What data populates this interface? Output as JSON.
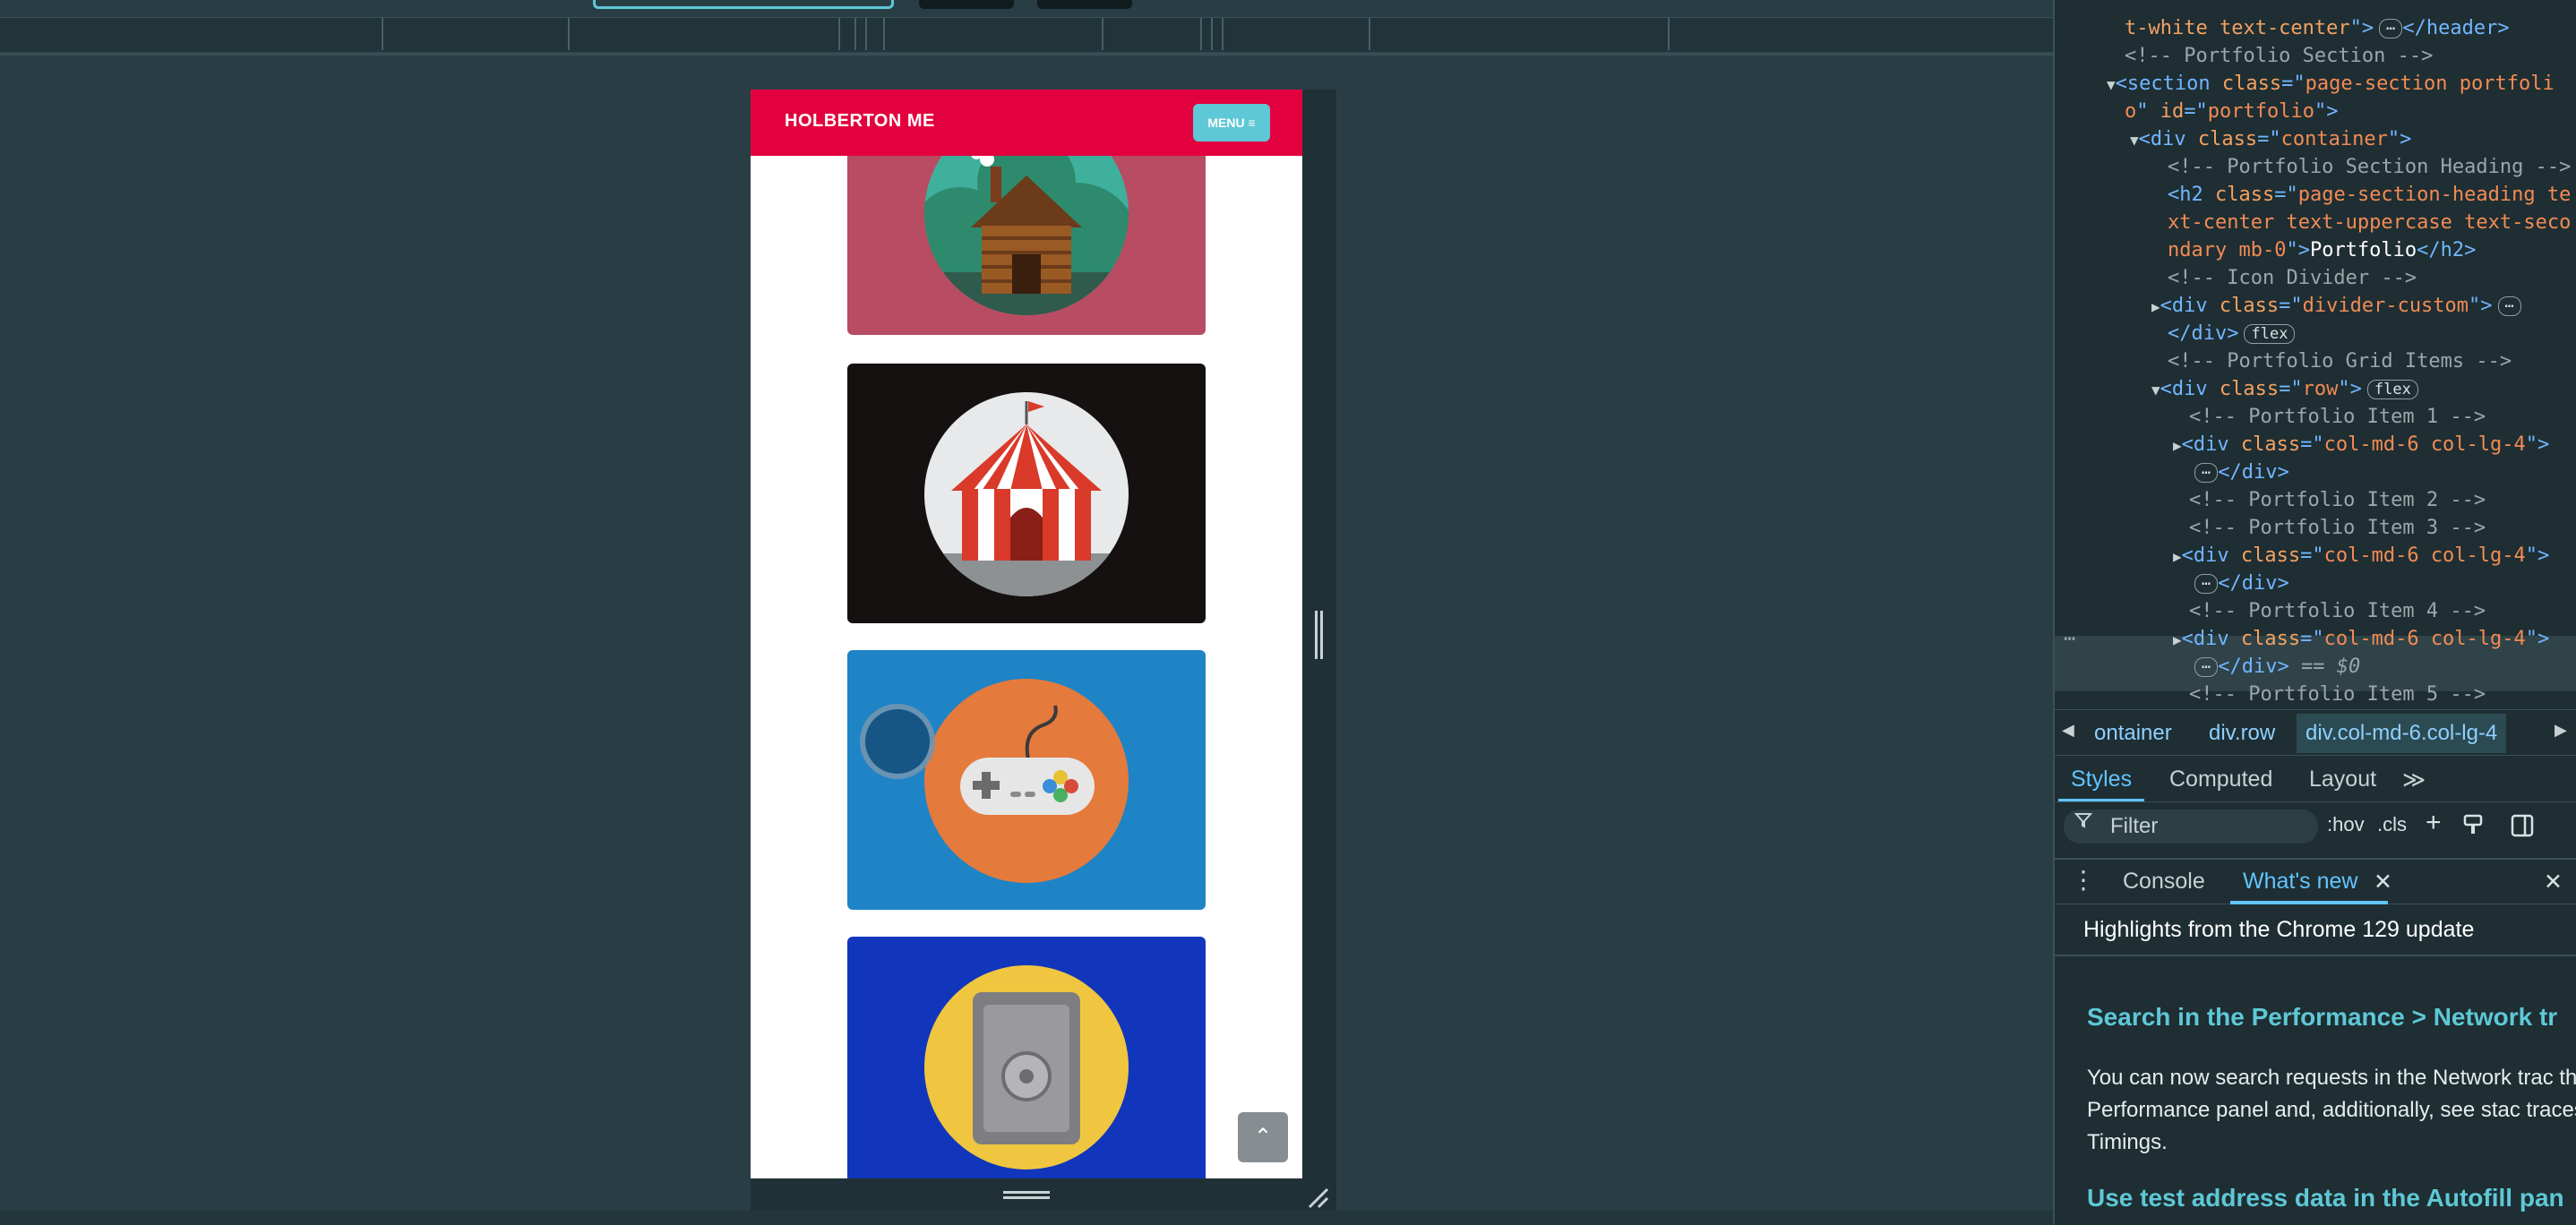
{
  "device": {
    "brand": "HOLBERTON ME",
    "menu_label": "MENU ≡",
    "scroll_top_glyph": "⌃",
    "portfolio_items": [
      {
        "name": "cabin",
        "bg": "#b84c62"
      },
      {
        "name": "circus-tent",
        "bg": "#141110"
      },
      {
        "name": "game-controller",
        "bg": "#1f84c6"
      },
      {
        "name": "safe",
        "bg": "#1236bb"
      }
    ]
  },
  "devtools": {
    "dom_lines": [
      {
        "indent": 0,
        "tri": "",
        "html": "<span class='attr'>t-white text-center</span><span class='tag'>\"&gt;</span><span class='badge'>⋯</span><span class='tag'>&lt;/header&gt;</span>"
      },
      {
        "indent": 0,
        "tri": "",
        "html": "<span class='cm'>&lt;!-- Portfolio Section --&gt;</span>"
      }
    ],
    "breadcrumb": [
      "ontainer",
      "div.row",
      "div.col-md-6.col-lg-4"
    ],
    "styles_tabs": [
      "Styles",
      "Computed",
      "Layout",
      "≫"
    ],
    "filter_placeholder": "Filter",
    "hov_label": ":hov",
    "cls_label": ".cls",
    "drawer_tabs": [
      "Console",
      "What's new"
    ],
    "whats_new": {
      "highlight": "Highlights from the Chrome 129 update",
      "heading1": "Search in the Performance > Network tr",
      "paragraph": "You can now search requests in the Network trac the Performance panel and, additionally, see stac traces in Timings.",
      "heading2": "Use test address data in the Autofill pan"
    }
  }
}
